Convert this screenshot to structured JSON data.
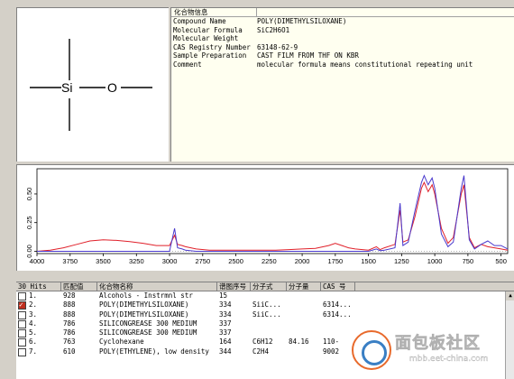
{
  "info": {
    "header_label": "化合物信息",
    "rows": [
      {
        "key": "Compound Name",
        "value": "POLY(DIMETHYLSILOXANE)"
      },
      {
        "key": "Molecular Formula",
        "value": "SiC2H6O1"
      },
      {
        "key": "Molecular Weight",
        "value": ""
      },
      {
        "key": "CAS Registry Number",
        "value": "63148-62-9"
      },
      {
        "key": "Sample Preparation",
        "value": "CAST FILM FROM THF ON KBR"
      },
      {
        "key": "Comment",
        "value": "molecular formula means constitutional repeating unit"
      }
    ]
  },
  "structure": {
    "atom1": "Si",
    "atom2": "O"
  },
  "chart_data": {
    "type": "line",
    "xlabel": "",
    "ylabel": "",
    "xlim": [
      4000,
      450
    ],
    "ylim": [
      -0.02,
      0.72
    ],
    "x_ticks": [
      "4000",
      "3750",
      "3500",
      "3250",
      "3000",
      "2750",
      "2500",
      "2250",
      "2000",
      "1750",
      "1500",
      "1250",
      "1000",
      "750",
      "500"
    ],
    "y_ticks": [
      "0.00",
      "0.25",
      "0.50"
    ],
    "series": [
      {
        "color": "#e0202a",
        "x": [
          4000,
          3900,
          3800,
          3700,
          3600,
          3500,
          3400,
          3300,
          3200,
          3100,
          3000,
          2962,
          2940,
          2905,
          2880,
          2800,
          2700,
          2600,
          2500,
          2400,
          2300,
          2200,
          2100,
          2000,
          1900,
          1800,
          1750,
          1700,
          1650,
          1600,
          1500,
          1440,
          1412,
          1380,
          1300,
          1261,
          1240,
          1200,
          1150,
          1100,
          1080,
          1050,
          1020,
          1000,
          950,
          900,
          860,
          800,
          780,
          740,
          700,
          650,
          600,
          550,
          500,
          450
        ],
        "y": [
          0.0,
          0.01,
          0.03,
          0.06,
          0.09,
          0.1,
          0.095,
          0.085,
          0.07,
          0.05,
          0.05,
          0.14,
          0.06,
          0.05,
          0.04,
          0.02,
          0.01,
          0.01,
          0.01,
          0.01,
          0.01,
          0.01,
          0.015,
          0.02,
          0.025,
          0.05,
          0.07,
          0.05,
          0.03,
          0.02,
          0.01,
          0.04,
          0.015,
          0.03,
          0.06,
          0.36,
          0.08,
          0.1,
          0.3,
          0.55,
          0.6,
          0.52,
          0.58,
          0.5,
          0.2,
          0.07,
          0.12,
          0.5,
          0.58,
          0.12,
          0.03,
          0.06,
          0.04,
          0.03,
          0.02,
          0.01
        ]
      },
      {
        "color": "#4a3acd",
        "x": [
          4000,
          3800,
          3600,
          3400,
          3200,
          3000,
          2962,
          2940,
          2905,
          2880,
          2800,
          2600,
          2400,
          2200,
          2000,
          1800,
          1700,
          1600,
          1500,
          1440,
          1412,
          1380,
          1300,
          1261,
          1240,
          1200,
          1150,
          1100,
          1080,
          1050,
          1020,
          1000,
          950,
          900,
          860,
          800,
          780,
          740,
          700,
          650,
          600,
          550,
          500,
          450
        ],
        "y": [
          0.0,
          0.0,
          0.0,
          0.0,
          0.0,
          0.0,
          0.2,
          0.03,
          0.02,
          0.01,
          0.0,
          0.0,
          0.0,
          0.0,
          0.0,
          0.0,
          0.0,
          0.0,
          0.0,
          0.02,
          0.005,
          0.01,
          0.03,
          0.42,
          0.05,
          0.08,
          0.35,
          0.6,
          0.66,
          0.58,
          0.64,
          0.55,
          0.15,
          0.04,
          0.08,
          0.55,
          0.66,
          0.1,
          0.02,
          0.06,
          0.09,
          0.05,
          0.05,
          0.02
        ]
      }
    ]
  },
  "hits": {
    "count_label": "30 Hits",
    "columns": [
      "匹配值",
      "化合物名称",
      "谱图序号",
      "分子式",
      "分子量",
      "CAS 号"
    ],
    "rows": [
      {
        "no": "1.",
        "checked": false,
        "score": "928",
        "name": "Alcohols - Instrmnl str",
        "reg": "15",
        "formula": "",
        "mw": "",
        "cas": ""
      },
      {
        "no": "2.",
        "checked": true,
        "score": "888",
        "name": "POLY(DIMETHYLSILOXANE)",
        "reg": "334",
        "formula": "SiiC...",
        "mw": "",
        "cas": "6314..."
      },
      {
        "no": "3.",
        "checked": false,
        "score": "888",
        "name": "POLY(DIMETHYLSILOXANE)",
        "reg": "334",
        "formula": "SiiC...",
        "mw": "",
        "cas": "6314..."
      },
      {
        "no": "4.",
        "checked": false,
        "score": "786",
        "name": "SILICONGREASE 300 MEDIUM",
        "reg": "337",
        "formula": "",
        "mw": "",
        "cas": ""
      },
      {
        "no": "5.",
        "checked": false,
        "score": "786",
        "name": "SILICONGREASE 300 MEDIUM",
        "reg": "337",
        "formula": "",
        "mw": "",
        "cas": ""
      },
      {
        "no": "6.",
        "checked": false,
        "score": "763",
        "name": "Cyclohexane",
        "reg": "164",
        "formula": "C6H12",
        "mw": "84.16",
        "cas": "110-"
      },
      {
        "no": "7.",
        "checked": false,
        "score": "610",
        "name": "POLY(ETHYLENE), low density",
        "reg": "344",
        "formula": "C2H4",
        "mw": "",
        "cas": "9002"
      }
    ]
  },
  "watermark": {
    "name": "面包板社区",
    "url": "mbb.eet-china.com",
    "ring_color": "#e86a2c",
    "inner_color": "#3a7fc4"
  }
}
